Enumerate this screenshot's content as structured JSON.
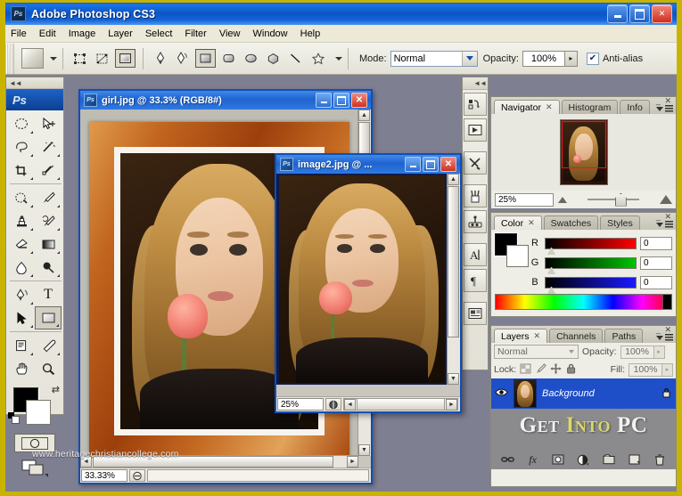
{
  "app": {
    "title": "Adobe Photoshop CS3",
    "logo_text": "Ps",
    "window_buttons": {
      "minimize": "_",
      "maximize": "□",
      "close": "✕"
    }
  },
  "menu": {
    "items": [
      {
        "label": "File"
      },
      {
        "label": "Edit"
      },
      {
        "label": "Image"
      },
      {
        "label": "Layer"
      },
      {
        "label": "Select"
      },
      {
        "label": "Filter"
      },
      {
        "label": "View"
      },
      {
        "label": "Window"
      },
      {
        "label": "Help"
      }
    ]
  },
  "options_bar": {
    "tool_preset_caret": "▾",
    "path_modes": [
      {
        "name": "shape-layers-icon",
        "selected": false
      },
      {
        "name": "paths-icon",
        "selected": false
      },
      {
        "name": "fill-pixels-icon",
        "selected": true
      }
    ],
    "shape_tools": [
      {
        "name": "pen-tool-icon",
        "selected": false
      },
      {
        "name": "freeform-pen-icon",
        "selected": false
      },
      {
        "name": "rectangle-tool-icon",
        "selected": true
      },
      {
        "name": "rounded-rectangle-icon",
        "selected": false
      },
      {
        "name": "ellipse-tool-icon",
        "selected": false
      },
      {
        "name": "polygon-tool-icon",
        "selected": false
      },
      {
        "name": "line-tool-icon",
        "selected": false
      },
      {
        "name": "custom-shape-icon",
        "selected": false
      }
    ],
    "shape_caret": "▾",
    "mode_label": "Mode:",
    "mode_value": "Normal",
    "opacity_label": "Opacity:",
    "opacity_value": "100%",
    "antialias_label": "Anti-alias",
    "antialias_checked": "✔"
  },
  "toolbox": {
    "logo": "Ps",
    "tools": [
      {
        "name": "elliptical-marquee-tool",
        "row": 0,
        "col": 0
      },
      {
        "name": "move-tool",
        "row": 0,
        "col": 1
      },
      {
        "name": "lasso-tool",
        "row": 1,
        "col": 0
      },
      {
        "name": "magic-wand-tool",
        "row": 1,
        "col": 1
      },
      {
        "name": "crop-tool",
        "row": 2,
        "col": 0
      },
      {
        "name": "slice-tool",
        "row": 2,
        "col": 1
      },
      {
        "name": "healing-brush-tool",
        "row": 3,
        "col": 0
      },
      {
        "name": "brush-tool",
        "row": 3,
        "col": 1
      },
      {
        "name": "clone-stamp-tool",
        "row": 4,
        "col": 0
      },
      {
        "name": "history-brush-tool",
        "row": 4,
        "col": 1
      },
      {
        "name": "eraser-tool",
        "row": 5,
        "col": 0
      },
      {
        "name": "gradient-tool",
        "row": 5,
        "col": 1
      },
      {
        "name": "blur-tool",
        "row": 6,
        "col": 0
      },
      {
        "name": "dodge-tool",
        "row": 6,
        "col": 1
      },
      {
        "name": "pen-tool",
        "row": 7,
        "col": 0
      },
      {
        "name": "type-tool",
        "row": 7,
        "col": 1
      },
      {
        "name": "path-selection-tool",
        "row": 8,
        "col": 0
      },
      {
        "name": "rectangle-shape-tool",
        "row": 8,
        "col": 1,
        "selected": true
      },
      {
        "name": "notes-tool",
        "row": 9,
        "col": 0
      },
      {
        "name": "eyedropper-tool",
        "row": 9,
        "col": 1
      },
      {
        "name": "hand-tool",
        "row": 10,
        "col": 0
      },
      {
        "name": "zoom-tool",
        "row": 10,
        "col": 1
      }
    ],
    "foreground_color": "#000000",
    "background_color": "#ffffff",
    "swap_icon": "⇄",
    "quickmask_label": "quick-mask-mode",
    "screenmode_label": "screen-mode"
  },
  "icon_rail": {
    "items": [
      {
        "name": "history-icon"
      },
      {
        "name": "actions-icon"
      },
      {
        "name": "tool-presets-icon"
      },
      {
        "name": "brushes-icon"
      },
      {
        "name": "clone-source-icon"
      },
      {
        "name": "character-icon",
        "glyph": "A"
      },
      {
        "name": "paragraph-icon",
        "glyph": "¶"
      },
      {
        "name": "layer-comps-icon"
      }
    ]
  },
  "documents": [
    {
      "id": "girl",
      "title": "girl.jpg @ 33.3% (RGB/8#)",
      "active": true,
      "zoom": "33.33%",
      "status_info": ""
    },
    {
      "id": "image2",
      "title": "image2.jpg @ ...",
      "active": true,
      "zoom": "25%",
      "status_info": ""
    }
  ],
  "palettes": {
    "navigator": {
      "tabs": [
        {
          "label": "Navigator",
          "active": true,
          "closable": true
        },
        {
          "label": "Histogram",
          "active": false,
          "closable": false
        },
        {
          "label": "Info",
          "active": false,
          "closable": false
        }
      ],
      "zoom_value": "25%",
      "minimize_glyph": "_",
      "close_glyph": "✕"
    },
    "color": {
      "tabs": [
        {
          "label": "Color",
          "active": true,
          "closable": true
        },
        {
          "label": "Swatches",
          "active": false,
          "closable": false
        },
        {
          "label": "Styles",
          "active": false,
          "closable": false
        }
      ],
      "channels": [
        {
          "label": "R",
          "value": "0"
        },
        {
          "label": "G",
          "value": "0"
        },
        {
          "label": "B",
          "value": "0"
        }
      ],
      "minimize_glyph": "_",
      "close_glyph": "✕"
    },
    "layers": {
      "tabs": [
        {
          "label": "Layers",
          "active": true,
          "closable": true
        },
        {
          "label": "Channels",
          "active": false,
          "closable": false
        },
        {
          "label": "Paths",
          "active": false,
          "closable": false
        }
      ],
      "blend_mode": "Normal",
      "opacity_label": "Opacity:",
      "opacity_value": "100%",
      "lock_label": "Lock:",
      "lock_icons": [
        {
          "name": "lock-transparent-pixels-icon"
        },
        {
          "name": "lock-image-pixels-icon"
        },
        {
          "name": "lock-position-icon"
        },
        {
          "name": "lock-all-icon"
        }
      ],
      "fill_label": "Fill:",
      "fill_value": "100%",
      "layer_rows": [
        {
          "name": "Background",
          "visible": true,
          "locked": true
        }
      ],
      "footer_icons": [
        {
          "name": "link-layers-icon"
        },
        {
          "name": "layer-style-icon",
          "glyph": "fx"
        },
        {
          "name": "layer-mask-icon"
        },
        {
          "name": "adjustment-layer-icon"
        },
        {
          "name": "new-group-icon"
        },
        {
          "name": "new-layer-icon"
        },
        {
          "name": "delete-layer-icon"
        }
      ],
      "minimize_glyph": "_",
      "close_glyph": "✕"
    }
  },
  "watermarks": {
    "site": "www.heritagechristiancollege.com",
    "brand_part1": "G",
    "brand_part1b": "ET",
    "brand_accent": "I",
    "brand_accent_b": "NTO",
    "brand_part2": "PC"
  },
  "colors": {
    "titlebar_blue": "#0b55c6",
    "accent_gold": "#c8b400",
    "layer_select_blue": "#1f4fc8",
    "frame_orange": "#c1651f",
    "close_red": "#cf2e1d"
  }
}
